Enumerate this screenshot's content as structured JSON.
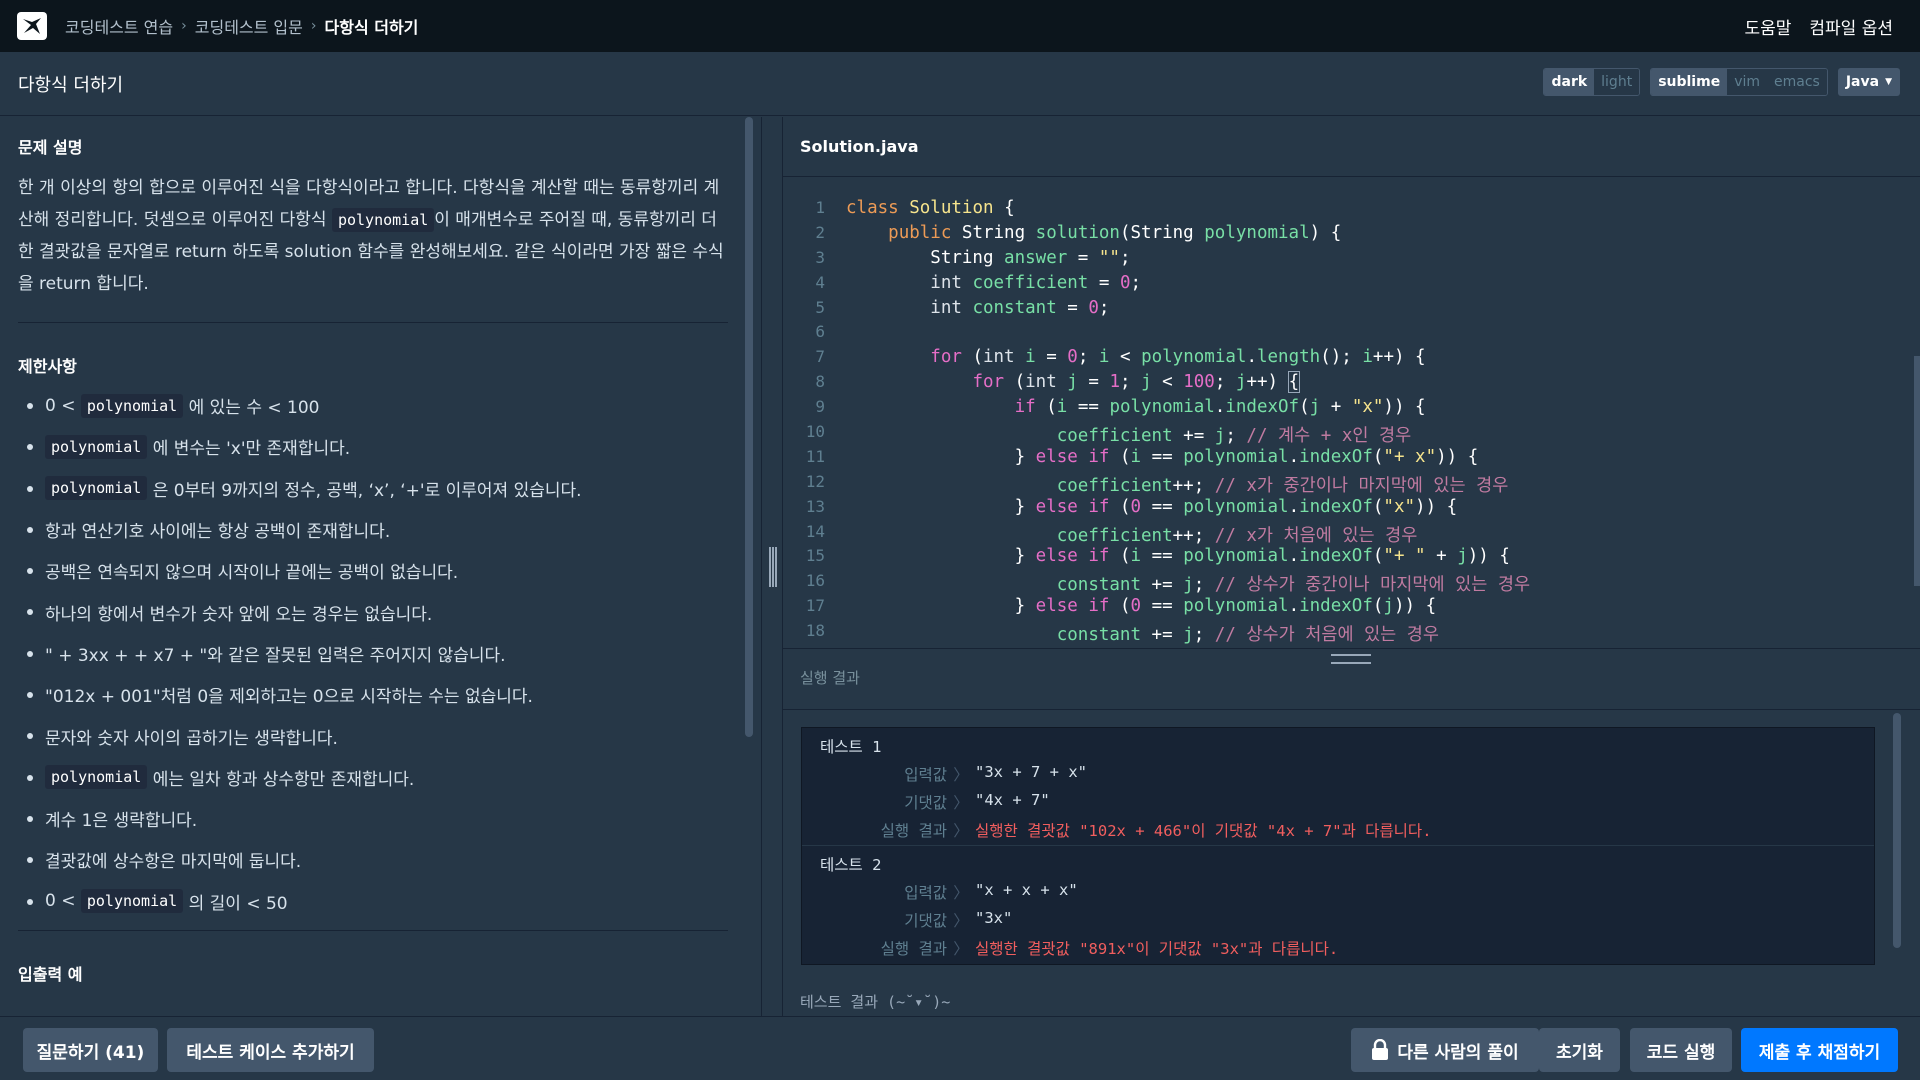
{
  "nav": {
    "breadcrumbs": [
      "코딩테스트 연습",
      "코딩테스트 입문",
      "다항식 더하기"
    ],
    "help": "도움말",
    "compile_options": "컴파일 옵션"
  },
  "title": "다항식 더하기",
  "toggles": {
    "theme": [
      "dark",
      "light"
    ],
    "keymap": [
      "sublime",
      "vim",
      "emacs"
    ],
    "language": "Java"
  },
  "problem": {
    "desc_title": "문제 설명",
    "desc_parts": [
      "한 개 이상의 항의 합으로 이루어진 식을 다항식이라고 합니다. 다항식을 계산할 때는 동류항끼리 계산해 정리합니다. 덧셈으로 이루어진 다항식 ",
      "polynomial",
      "이 매개변수로 주어질 때, 동류항끼리 더한 결괏값을 문자열로 return 하도록 solution 함수를 완성해보세요. 같은 식이라면 가장 짧은 수식을 return 합니다."
    ],
    "constraints_title": "제한사항",
    "constraints": [
      {
        "pre": "0 < ",
        "code": "polynomial",
        "post": " 에 있는 수 < 100"
      },
      {
        "pre": "",
        "code": "polynomial",
        "post": " 에 변수는 'x'만 존재합니다."
      },
      {
        "pre": "",
        "code": "polynomial",
        "post": " 은 0부터 9까지의 정수, 공백, ‘x’, ‘+'로 이루어져 있습니다."
      },
      {
        "pre": "항과 연산기호 사이에는 항상 공백이 존재합니다.",
        "code": "",
        "post": ""
      },
      {
        "pre": "공백은 연속되지 않으며 시작이나 끝에는 공백이 없습니다.",
        "code": "",
        "post": ""
      },
      {
        "pre": "하나의 항에서 변수가 숫자 앞에 오는 경우는 없습니다.",
        "code": "",
        "post": ""
      },
      {
        "pre": "\" + 3xx + + x7 + \"와 같은 잘못된 입력은 주어지지 않습니다.",
        "code": "",
        "post": ""
      },
      {
        "pre": "\"012x + 001\"처럼 0을 제외하고는 0으로 시작하는 수는 없습니다.",
        "code": "",
        "post": ""
      },
      {
        "pre": "문자와 숫자 사이의 곱하기는 생략합니다.",
        "code": "",
        "post": ""
      },
      {
        "pre": "",
        "code": "polynomial",
        "post": " 에는 일차 항과 상수항만 존재합니다."
      },
      {
        "pre": "계수 1은 생략합니다.",
        "code": "",
        "post": ""
      },
      {
        "pre": "결괏값에 상수항은 마지막에 둡니다.",
        "code": "",
        "post": ""
      },
      {
        "pre": "0 < ",
        "code": "polynomial",
        "post": " 의 길이 < 50"
      }
    ],
    "io_title": "입출력 예"
  },
  "editor": {
    "filename": "Solution.java",
    "line_numbers": [
      "1",
      "2",
      "3",
      "4",
      "5",
      "6",
      "7",
      "8",
      "9",
      "10",
      "11",
      "12",
      "13",
      "14",
      "15",
      "16",
      "17",
      "18"
    ]
  },
  "results": {
    "header": "실행 결과",
    "label_input": "입력값",
    "label_expected": "기댓값",
    "label_result": "실행 결과",
    "arrow": "〉",
    "tests": [
      {
        "name": "테스트 1",
        "input": "\"3x + 7 + x\"",
        "expected": "\"4x + 7\"",
        "result": "실행한 결괏값 \"102x + 466\"이 기댓값 \"4x + 7\"과 다릅니다."
      },
      {
        "name": "테스트 2",
        "input": "\"x + x + x\"",
        "expected": "\"3x\"",
        "result": "실행한 결괏값 \"891x\"이 기댓값 \"3x\"과 다릅니다."
      }
    ],
    "summary": "테스트 결과 (~˘▾˘)~"
  },
  "buttons": {
    "ask": "질문하기 (41)",
    "add_testcase": "테스트 케이스 추가하기",
    "others_solution": "다른 사람의 풀이",
    "reset": "초기화",
    "run": "코드 실행",
    "submit": "제출 후 채점하기"
  }
}
